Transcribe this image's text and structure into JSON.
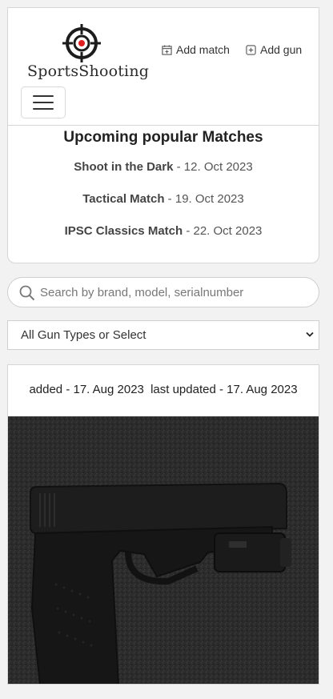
{
  "brand": {
    "name": "SportsShooting"
  },
  "nav": {
    "add_match": "Add match",
    "add_gun": "Add gun"
  },
  "matches": {
    "title": "Upcoming popular Matches",
    "items": [
      {
        "name": "Shoot in the Dark",
        "date": " - 12. Oct 2023"
      },
      {
        "name": "Tactical Match",
        "date": " - 19. Oct 2023"
      },
      {
        "name": "IPSC Classics Match",
        "date": " - 22. Oct 2023"
      }
    ]
  },
  "search": {
    "placeholder": "Search by brand, model, serialnumber",
    "value": ""
  },
  "filter": {
    "selected": "All Gun Types or Select"
  },
  "gun": {
    "added": "added - 17. Aug 2023",
    "updated": "last updated - 17. Aug 2023"
  },
  "colors": {
    "logo_accent": "#e02020",
    "border": "#d6d6d6"
  }
}
